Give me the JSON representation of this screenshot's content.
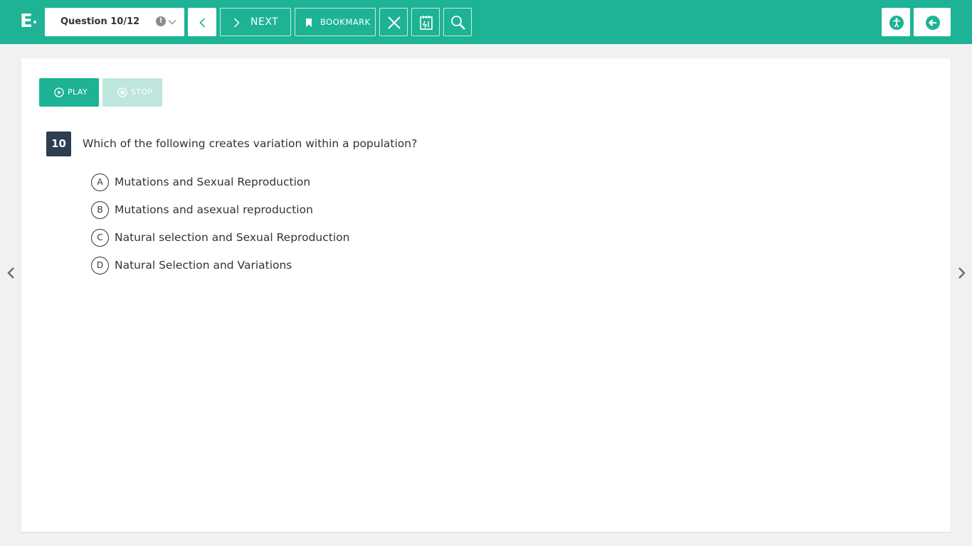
{
  "header": {
    "logo_text": "E",
    "question_selector": {
      "label": "Question 10/12",
      "warning_glyph": "!"
    },
    "next_label": "NEXT",
    "bookmark_label": "BOOKMARK",
    "icons": {
      "prev": "chevron-left-icon",
      "next": "chevron-right-icon",
      "bookmark": "bookmark-icon",
      "eliminate": "close-icon",
      "notepad": "notepad-icon",
      "magnifier": "magnifier-icon",
      "accessibility": "accessibility-icon",
      "exit": "exit-arrow-icon"
    }
  },
  "audio": {
    "play_label": "PLAY",
    "stop_label": "STOP"
  },
  "question": {
    "number": "10",
    "text": "Which of the following creates variation within a population?",
    "options": [
      {
        "letter": "A",
        "text": "Mutations and Sexual Reproduction"
      },
      {
        "letter": "B",
        "text": "Mutations and asexual reproduction"
      },
      {
        "letter": "C",
        "text": "Natural selection and Sexual Reproduction"
      },
      {
        "letter": "D",
        "text": "Natural Selection and Variations"
      }
    ]
  },
  "colors": {
    "accent": "#1db394",
    "question_badge": "#2c3e50",
    "stop_disabled": "#bfe6dd",
    "background": "#f1f1f2"
  }
}
